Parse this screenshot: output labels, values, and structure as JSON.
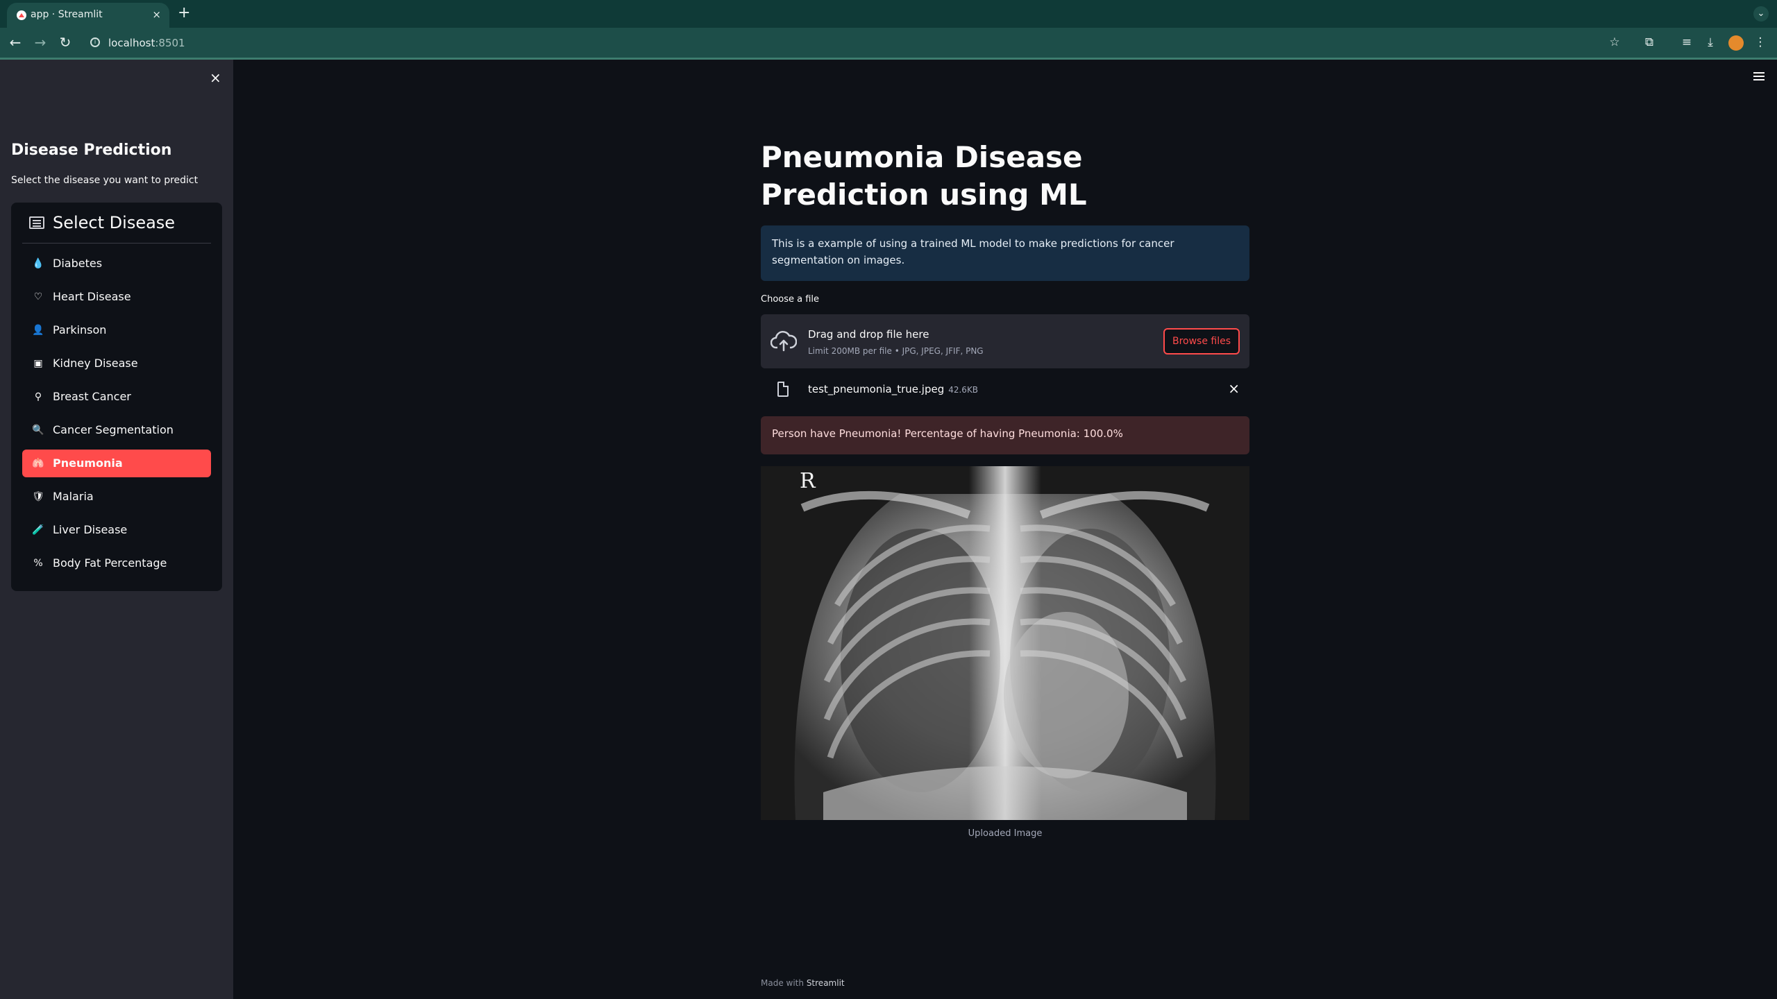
{
  "browser": {
    "tab_title": "app · Streamlit",
    "tab_close": "×",
    "new_tab": "+",
    "tab_menu": "⌄",
    "url_host": "localhost",
    "url_port": ":8501"
  },
  "sidebar": {
    "close": "×",
    "title": "Disease Prediction",
    "subtitle": "Select the disease you want to predict",
    "menu_title": "Select Disease",
    "items": [
      {
        "label": "Diabetes",
        "icon": "💧"
      },
      {
        "label": "Heart Disease",
        "icon": "♡"
      },
      {
        "label": "Parkinson",
        "icon": "👤"
      },
      {
        "label": "Kidney Disease",
        "icon": "▣"
      },
      {
        "label": "Breast Cancer",
        "icon": "⚲"
      },
      {
        "label": "Cancer Segmentation",
        "icon": "🔍"
      },
      {
        "label": "Pneumonia",
        "icon": "🫁"
      },
      {
        "label": "Malaria",
        "icon": "🛡"
      },
      {
        "label": "Liver Disease",
        "icon": "🧪"
      },
      {
        "label": "Body Fat Percentage",
        "icon": "%"
      }
    ],
    "active_index": 6,
    "accent_color": "#ff4b4b"
  },
  "main": {
    "title": "Pneumonia Disease Prediction using ML",
    "info": "This is a example of using a trained ML model to make predictions for cancer segmentation on images.",
    "uploader": {
      "label": "Choose a file",
      "drop_text": "Drag and drop file here",
      "limit_text": "Limit 200MB per file • JPG, JPEG, JFIF, PNG",
      "browse_label": "Browse files"
    },
    "file": {
      "name": "test_pneumonia_true.jpeg",
      "size": "42.6KB",
      "remove": "×"
    },
    "result": "Person have Pneumonia! Percentage of having Pneumonia: 100.0%",
    "image_marker": "R",
    "image_caption": "Uploaded Image"
  },
  "footer": {
    "prefix": "Made with",
    "brand": "Streamlit"
  }
}
